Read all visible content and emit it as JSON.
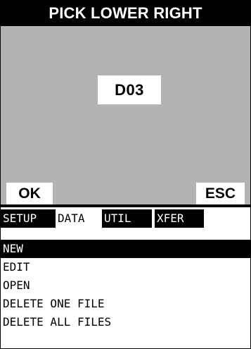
{
  "dialog": {
    "title": "PICK LOWER RIGHT",
    "value": "D03",
    "ok_label": "OK",
    "esc_label": "ESC"
  },
  "tabs": [
    {
      "label": "SETUP",
      "active": false
    },
    {
      "label": "DATA",
      "active": true
    },
    {
      "label": "UTIL",
      "active": false
    },
    {
      "label": "XFER",
      "active": false
    }
  ],
  "menu": {
    "items": [
      {
        "label": "NEW",
        "selected": true
      },
      {
        "label": "EDIT",
        "selected": false
      },
      {
        "label": "OPEN",
        "selected": false
      },
      {
        "label": "DELETE ONE FILE",
        "selected": false
      },
      {
        "label": "DELETE ALL FILES",
        "selected": false
      }
    ]
  },
  "colors": {
    "panel": "#b3b3b3",
    "title_bg": "#000000",
    "highlight": "#000000",
    "text_light": "#ffffff"
  }
}
